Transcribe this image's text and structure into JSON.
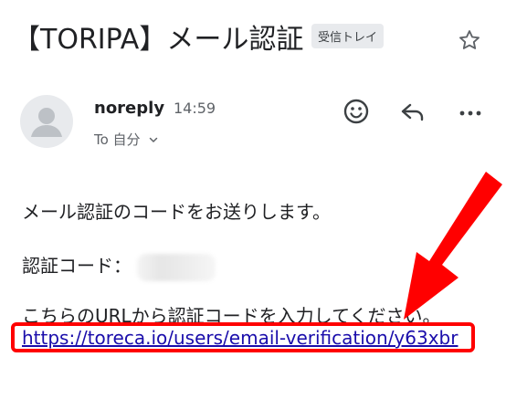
{
  "email": {
    "subject": "【TORIPA】メール認証",
    "label": "受信トレイ",
    "sender": "noreply",
    "time": "14:59",
    "recipient": "To 自分",
    "body": {
      "line1": "メール認証のコードをお送りします。",
      "line2_prefix": "認証コード：",
      "line3": "こちらのURLから認証コードを入力してください。",
      "link": "https://toreca.io/users/email-verification/y63xbr"
    }
  },
  "icons": {
    "star": "star-outline-icon",
    "avatar": "person-icon",
    "emoji": "add-emoji-icon",
    "reply": "reply-icon",
    "more": "more-horizontal-icon",
    "chevron": "chevron-down-icon"
  },
  "colors": {
    "highlight": "#ff0000",
    "link": "#1a0dab",
    "chip_bg": "#e8eaed"
  }
}
